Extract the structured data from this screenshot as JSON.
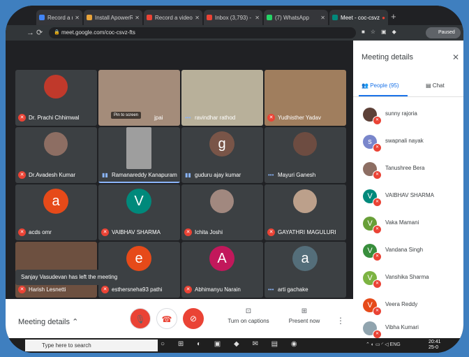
{
  "browser": {
    "tabs": [
      {
        "label": "Record a meet",
        "color": "#4285f4"
      },
      {
        "label": "Install ApowerREC",
        "color": "#e8a33a"
      },
      {
        "label": "Record a video meet",
        "color": "#ea4335"
      },
      {
        "label": "Inbox (3,793) - dr.a",
        "color": "#ea4335"
      },
      {
        "label": "(7) WhatsApp",
        "color": "#25d366"
      },
      {
        "label": "Meet - coc-csvz",
        "color": "#00897b"
      }
    ],
    "url": "meet.google.com/coc-csvz-fts",
    "paused_label": "Paused"
  },
  "grid": {
    "tiles": [
      {
        "name": "Dr. Prachi Chhimwal",
        "status": "muted",
        "type": "photo",
        "color": "#c0392b"
      },
      {
        "name": "jpai",
        "status": "none",
        "type": "video",
        "color": "#a48c7a",
        "pin": "Pin to screen"
      },
      {
        "name": "ravindhar rathod",
        "status": "talking-dots",
        "type": "video",
        "color": "#b8b09a"
      },
      {
        "name": "Yudhisther Yadav",
        "status": "muted",
        "type": "video",
        "color": "#a07e5e"
      },
      {
        "name": "Dr.Avadesh Kumar",
        "status": "muted",
        "type": "photo",
        "color": "#8d6e63"
      },
      {
        "name": "Ramanareddy Kanapuram",
        "status": "speaking",
        "type": "video",
        "color": "#9e9e9e",
        "active": true
      },
      {
        "name": "guduru ajay kumar",
        "status": "speaking",
        "type": "letter",
        "letter": "g",
        "color": "#795548"
      },
      {
        "name": "Mayuri Ganesh",
        "status": "talking-dots",
        "type": "photo",
        "color": "#6d4c41"
      },
      {
        "name": "acds omr",
        "status": "muted",
        "type": "letter",
        "letter": "a",
        "color": "#e64a19"
      },
      {
        "name": "VAIBHAV SHARMA",
        "status": "muted",
        "type": "letter",
        "letter": "V",
        "color": "#00897b"
      },
      {
        "name": "Ichita Joshi",
        "status": "muted",
        "type": "photo",
        "color": "#a1887f"
      },
      {
        "name": "GAYATHRI MAGULURI",
        "status": "muted",
        "type": "photo",
        "color": "#bca08b"
      },
      {
        "name": "Harish Lesnetti",
        "status": "muted",
        "type": "video",
        "color": "#6d5040"
      },
      {
        "name": "esthersneha93 pathi",
        "status": "muted",
        "type": "letter",
        "letter": "e",
        "color": "#e64a19"
      },
      {
        "name": "Abhimanyu Narain",
        "status": "muted",
        "type": "letter",
        "letter": "A",
        "color": "#c2185b"
      },
      {
        "name": "arti gachake",
        "status": "talking-dots",
        "type": "letter",
        "letter": "a",
        "color": "#546e7a"
      }
    ],
    "toast": "Sanjay Vasudevan has left the meeting"
  },
  "controls": {
    "meeting_details": "Meeting details",
    "captions": "Turn on captions",
    "present": "Present now"
  },
  "panel": {
    "title": "Meeting details",
    "people_tab": "People (95)",
    "chat_tab": "Chat",
    "people": [
      {
        "name": "sunny rajoria",
        "letter": "",
        "color": "#5d4037"
      },
      {
        "name": "swapnali nayak",
        "letter": "s",
        "color": "#7986cb"
      },
      {
        "name": "Tanushree Bera",
        "letter": "",
        "color": "#8d6e63"
      },
      {
        "name": "VAIBHAV SHARMA",
        "letter": "V",
        "color": "#00897b"
      },
      {
        "name": "Vaka Mamani",
        "letter": "V",
        "color": "#689f38"
      },
      {
        "name": "Vandana Singh",
        "letter": "V",
        "color": "#388e3c"
      },
      {
        "name": "Vanshika Sharma",
        "letter": "V",
        "color": "#7cb342"
      },
      {
        "name": "Veera Reddy",
        "letter": "V",
        "color": "#e64a19"
      },
      {
        "name": "Vibha Kumari",
        "letter": "",
        "color": "#90a4ae"
      }
    ]
  },
  "taskbar": {
    "search_placeholder": "Type here to search",
    "tray": "ENG",
    "time": "20:41",
    "date": "25-0"
  }
}
